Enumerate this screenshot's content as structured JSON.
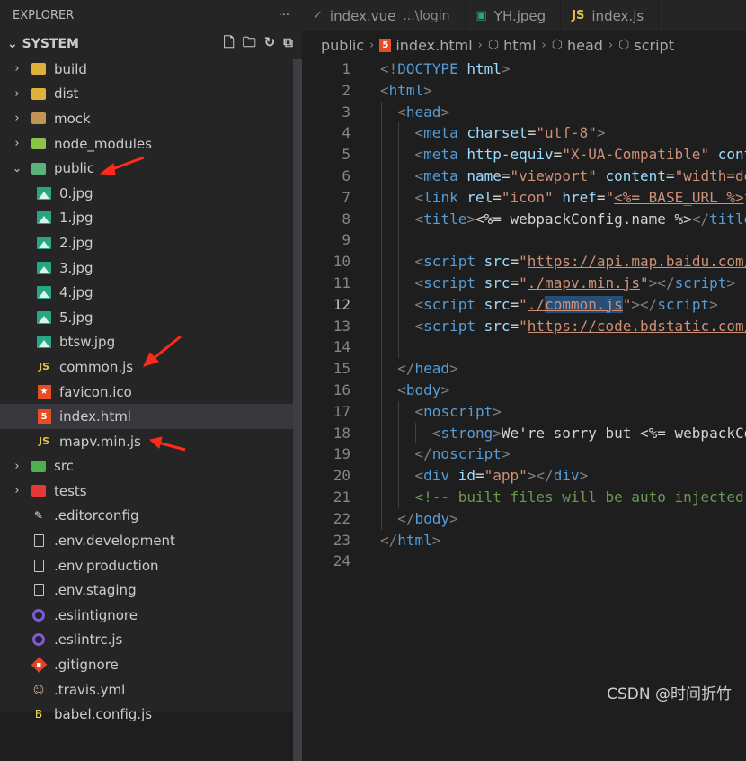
{
  "explorer": {
    "title": "EXPLORER",
    "more": "···",
    "section": "SYSTEM",
    "actions": [
      "new-file-icon",
      "new-folder-icon",
      "refresh-icon",
      "collapse-all-icon"
    ]
  },
  "tree": [
    {
      "label": "build",
      "type": "folder",
      "icon": "folder-icon",
      "color": "#e0b13a",
      "level": 0,
      "expanded": false
    },
    {
      "label": "dist",
      "type": "folder",
      "icon": "folder-icon",
      "color": "#e0b13a",
      "level": 0,
      "expanded": false
    },
    {
      "label": "mock",
      "type": "folder",
      "icon": "folder-icon",
      "color": "#c09553",
      "level": 0,
      "expanded": false
    },
    {
      "label": "node_modules",
      "type": "folder",
      "icon": "node-folder-icon",
      "color": "#8bc34a",
      "level": 0,
      "expanded": false
    },
    {
      "label": "public",
      "type": "folder",
      "icon": "public-folder-icon",
      "color": "#5bb37b",
      "level": 0,
      "expanded": true
    },
    {
      "label": "0.jpg",
      "type": "image",
      "level": 1
    },
    {
      "label": "1.jpg",
      "type": "image",
      "level": 1
    },
    {
      "label": "2.jpg",
      "type": "image",
      "level": 1
    },
    {
      "label": "3.jpg",
      "type": "image",
      "level": 1
    },
    {
      "label": "4.jpg",
      "type": "image",
      "level": 1
    },
    {
      "label": "5.jpg",
      "type": "image",
      "level": 1
    },
    {
      "label": "btsw.jpg",
      "type": "image",
      "level": 1
    },
    {
      "label": "common.js",
      "type": "js",
      "level": 1
    },
    {
      "label": "favicon.ico",
      "type": "favicon",
      "level": 1
    },
    {
      "label": "index.html",
      "type": "html",
      "level": 1,
      "selected": true
    },
    {
      "label": "mapv.min.js",
      "type": "js",
      "level": 1
    },
    {
      "label": "src",
      "type": "folder",
      "icon": "src-folder-icon",
      "color": "#4caf50",
      "level": 0,
      "expanded": false
    },
    {
      "label": "tests",
      "type": "folder",
      "icon": "tests-folder-icon",
      "color": "#e53935",
      "level": 0,
      "expanded": false
    },
    {
      "label": ".editorconfig",
      "type": "editorconfig",
      "level": 0
    },
    {
      "label": ".env.development",
      "type": "file",
      "level": 0
    },
    {
      "label": ".env.production",
      "type": "file",
      "level": 0
    },
    {
      "label": ".env.staging",
      "type": "file",
      "level": 0
    },
    {
      "label": ".eslintignore",
      "type": "eslint",
      "level": 0
    },
    {
      "label": ".eslintrc.js",
      "type": "eslint",
      "level": 0
    },
    {
      "label": ".gitignore",
      "type": "git",
      "level": 0
    },
    {
      "label": ".travis.yml",
      "type": "travis",
      "level": 0
    },
    {
      "label": "babel.config.js",
      "type": "babel",
      "level": 0
    }
  ],
  "tabs": [
    {
      "label": "index.vue",
      "detail": "...\\login",
      "icon": "vue-icon",
      "active": false
    },
    {
      "label": "YH.jpeg",
      "detail": "",
      "icon": "image-icon",
      "active": false
    },
    {
      "label": "index.js",
      "detail": "",
      "icon": "js-icon",
      "active": false
    }
  ],
  "breadcrumb": [
    "public",
    "index.html",
    "html",
    "head",
    "script"
  ],
  "editor": {
    "current_line": 12,
    "lines": [
      {
        "n": 1,
        "tokens": [
          [
            "pun",
            "<!"
          ],
          [
            "tag",
            "DOCTYPE"
          ],
          [
            "txt",
            " "
          ],
          [
            "attr",
            "html"
          ],
          [
            "pun",
            ">"
          ]
        ]
      },
      {
        "n": 2,
        "tokens": [
          [
            "pun",
            "<"
          ],
          [
            "tag",
            "html"
          ],
          [
            "pun",
            ">"
          ]
        ]
      },
      {
        "n": 3,
        "tokens": [
          [
            "txt",
            "  "
          ],
          [
            "pun",
            "<"
          ],
          [
            "tag",
            "head"
          ],
          [
            "pun",
            ">"
          ]
        ]
      },
      {
        "n": 4,
        "tokens": [
          [
            "txt",
            "    "
          ],
          [
            "pun",
            "<"
          ],
          [
            "tag",
            "meta"
          ],
          [
            "txt",
            " "
          ],
          [
            "attr",
            "charset"
          ],
          [
            "txt",
            "="
          ],
          [
            "str",
            "\"utf-8\""
          ],
          [
            "pun",
            ">"
          ]
        ]
      },
      {
        "n": 5,
        "tokens": [
          [
            "txt",
            "    "
          ],
          [
            "pun",
            "<"
          ],
          [
            "tag",
            "meta"
          ],
          [
            "txt",
            " "
          ],
          [
            "attr",
            "http-equiv"
          ],
          [
            "txt",
            "="
          ],
          [
            "str",
            "\"X-UA-Compatible\""
          ],
          [
            "txt",
            " "
          ],
          [
            "attr",
            "cont"
          ]
        ]
      },
      {
        "n": 6,
        "tokens": [
          [
            "txt",
            "    "
          ],
          [
            "pun",
            "<"
          ],
          [
            "tag",
            "meta"
          ],
          [
            "txt",
            " "
          ],
          [
            "attr",
            "name"
          ],
          [
            "txt",
            "="
          ],
          [
            "str",
            "\"viewport\""
          ],
          [
            "txt",
            " "
          ],
          [
            "attr",
            "content"
          ],
          [
            "txt",
            "="
          ],
          [
            "str",
            "\"width=de"
          ]
        ]
      },
      {
        "n": 7,
        "tokens": [
          [
            "txt",
            "    "
          ],
          [
            "pun",
            "<"
          ],
          [
            "tag",
            "link"
          ],
          [
            "txt",
            " "
          ],
          [
            "attr",
            "rel"
          ],
          [
            "txt",
            "="
          ],
          [
            "str",
            "\"icon\""
          ],
          [
            "txt",
            " "
          ],
          [
            "attr",
            "href"
          ],
          [
            "txt",
            "="
          ],
          [
            "str",
            "\""
          ],
          [
            "url",
            "<%= BASE_URL %>"
          ],
          [
            "str",
            "f"
          ]
        ]
      },
      {
        "n": 8,
        "tokens": [
          [
            "txt",
            "    "
          ],
          [
            "pun",
            "<"
          ],
          [
            "tag",
            "title"
          ],
          [
            "pun",
            ">"
          ],
          [
            "txt",
            "<%= webpackConfig.name %>"
          ],
          [
            "pun",
            "</"
          ],
          [
            "tag",
            "title"
          ]
        ]
      },
      {
        "n": 9,
        "tokens": []
      },
      {
        "n": 10,
        "tokens": [
          [
            "txt",
            "    "
          ],
          [
            "pun",
            "<"
          ],
          [
            "tag",
            "script"
          ],
          [
            "txt",
            " "
          ],
          [
            "attr",
            "src"
          ],
          [
            "txt",
            "="
          ],
          [
            "str",
            "\""
          ],
          [
            "url",
            "https://api.map.baidu.com/"
          ]
        ]
      },
      {
        "n": 11,
        "tokens": [
          [
            "txt",
            "    "
          ],
          [
            "pun",
            "<"
          ],
          [
            "tag",
            "script"
          ],
          [
            "txt",
            " "
          ],
          [
            "attr",
            "src"
          ],
          [
            "txt",
            "="
          ],
          [
            "str",
            "\""
          ],
          [
            "url",
            "./mapv.min.js"
          ],
          [
            "str",
            "\""
          ],
          [
            "pun",
            "></"
          ],
          [
            "tag",
            "script"
          ],
          [
            "pun",
            ">"
          ]
        ]
      },
      {
        "n": 12,
        "tokens": [
          [
            "txt",
            "    "
          ],
          [
            "pun",
            "<"
          ],
          [
            "tag",
            "script"
          ],
          [
            "txt",
            " "
          ],
          [
            "attr",
            "src"
          ],
          [
            "txt",
            "="
          ],
          [
            "str",
            "\""
          ],
          [
            "url",
            "./"
          ],
          [
            "url hl",
            "common.js"
          ],
          [
            "str",
            "\""
          ],
          [
            "pun",
            "></"
          ],
          [
            "tag",
            "script"
          ],
          [
            "pun",
            ">"
          ]
        ]
      },
      {
        "n": 13,
        "tokens": [
          [
            "txt",
            "    "
          ],
          [
            "pun",
            "<"
          ],
          [
            "tag",
            "script"
          ],
          [
            "txt",
            " "
          ],
          [
            "attr",
            "src"
          ],
          [
            "txt",
            "="
          ],
          [
            "str",
            "\""
          ],
          [
            "url",
            "https://code.bdstatic.com/"
          ]
        ]
      },
      {
        "n": 14,
        "tokens": []
      },
      {
        "n": 15,
        "tokens": [
          [
            "txt",
            "  "
          ],
          [
            "pun",
            "</"
          ],
          [
            "tag",
            "head"
          ],
          [
            "pun",
            ">"
          ]
        ]
      },
      {
        "n": 16,
        "tokens": [
          [
            "txt",
            "  "
          ],
          [
            "pun",
            "<"
          ],
          [
            "tag",
            "body"
          ],
          [
            "pun",
            ">"
          ]
        ]
      },
      {
        "n": 17,
        "tokens": [
          [
            "txt",
            "    "
          ],
          [
            "pun",
            "<"
          ],
          [
            "tag",
            "noscript"
          ],
          [
            "pun",
            ">"
          ]
        ]
      },
      {
        "n": 18,
        "tokens": [
          [
            "txt",
            "      "
          ],
          [
            "pun",
            "<"
          ],
          [
            "tag",
            "strong"
          ],
          [
            "pun",
            ">"
          ],
          [
            "txt",
            "We're sorry but <%= webpackCo"
          ]
        ]
      },
      {
        "n": 19,
        "tokens": [
          [
            "txt",
            "    "
          ],
          [
            "pun",
            "</"
          ],
          [
            "tag",
            "noscript"
          ],
          [
            "pun",
            ">"
          ]
        ]
      },
      {
        "n": 20,
        "tokens": [
          [
            "txt",
            "    "
          ],
          [
            "pun",
            "<"
          ],
          [
            "tag",
            "div"
          ],
          [
            "txt",
            " "
          ],
          [
            "attr",
            "id"
          ],
          [
            "txt",
            "="
          ],
          [
            "str",
            "\"app\""
          ],
          [
            "pun",
            "></"
          ],
          [
            "tag",
            "div"
          ],
          [
            "pun",
            ">"
          ]
        ]
      },
      {
        "n": 21,
        "tokens": [
          [
            "txt",
            "    "
          ],
          [
            "cmt",
            "<!-- built files will be auto injected"
          ]
        ]
      },
      {
        "n": 22,
        "tokens": [
          [
            "txt",
            "  "
          ],
          [
            "pun",
            "</"
          ],
          [
            "tag",
            "body"
          ],
          [
            "pun",
            ">"
          ]
        ]
      },
      {
        "n": 23,
        "tokens": [
          [
            "pun",
            "</"
          ],
          [
            "tag",
            "html"
          ],
          [
            "pun",
            ">"
          ]
        ]
      },
      {
        "n": 24,
        "tokens": []
      }
    ]
  },
  "watermark": "CSDN @时间折竹",
  "colors": {
    "annotation_arrow": "#ff2a1a",
    "accent": "#264f78"
  }
}
